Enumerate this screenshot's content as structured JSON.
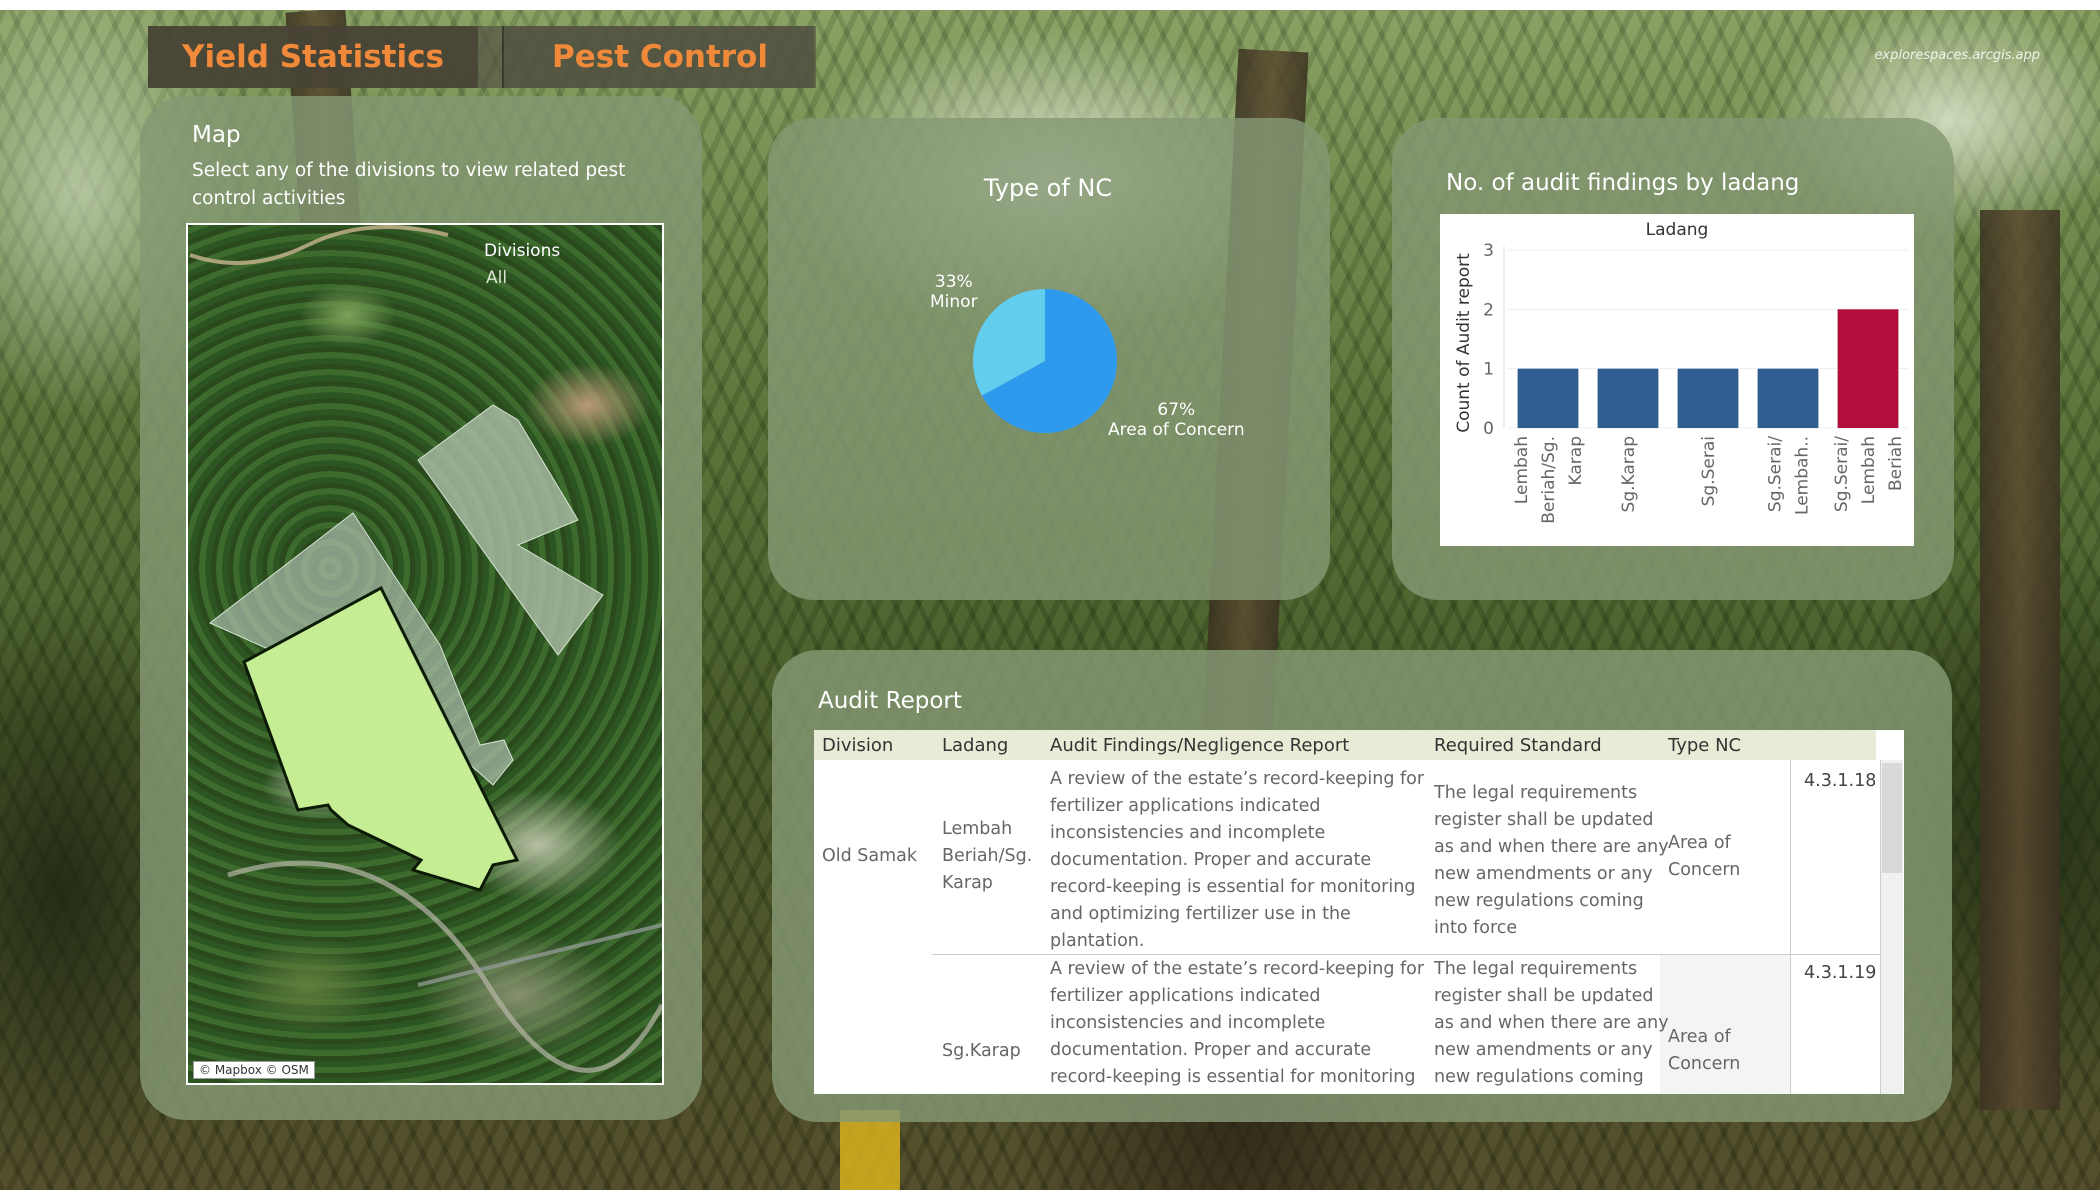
{
  "tabs": [
    {
      "label": "Yield Statistics",
      "active": true
    },
    {
      "label": "Pest Control",
      "active": false
    }
  ],
  "header_url": "explorespaces.arcgis.app",
  "map_panel": {
    "title": "Map",
    "subtitle_line1": "Select any of the divisions to view related pest",
    "subtitle_line2": "control activities",
    "filter_label": "Divisions",
    "filter_value": "All",
    "credit": "© Mapbox © OSM",
    "highlight_color": "#c5ee94"
  },
  "nc_panel": {
    "title": "Type of NC",
    "slices": [
      {
        "name": "Minor",
        "percent": "33%",
        "value": 33,
        "color": "#63cdee"
      },
      {
        "name": "Area of Concern",
        "percent": "67%",
        "value": 67,
        "color": "#2d9aee"
      }
    ]
  },
  "audit_chart": {
    "title": "No. of audit findings by ladang",
    "header": "Ladang",
    "ylabel": "Count of Audit report",
    "colors": {
      "normal": "#2f5d8f",
      "highlight": "#b20e3b"
    },
    "chart_data": {
      "type": "bar",
      "categories": [
        "Lembah Beriah/Sg. Karap",
        "Sg.Karap",
        "Sg.Serai",
        "Sg.Serai/ Lembah..",
        "Sg.Serai/ Lembah Beriah"
      ],
      "tick_lines": [
        [
          "Lembah",
          "Beriah/Sg.",
          "Karap"
        ],
        [
          "Sg.Karap"
        ],
        [
          "Sg.Serai"
        ],
        [
          "Sg.Serai/",
          "Lembah.."
        ],
        [
          "Sg.Serai/",
          "Lembah",
          "Beriah"
        ]
      ],
      "values": [
        1,
        1,
        1,
        1,
        2
      ],
      "yticks": [
        "0",
        "1",
        "2",
        "3"
      ],
      "ylim": [
        0,
        3
      ],
      "ylabel": "Count of Audit report",
      "grid": true
    }
  },
  "audit_report": {
    "title": "Audit Report",
    "columns": [
      "Division",
      "Ladang",
      "Audit Findings/Negligence Report",
      "Required Standard",
      "Type NC"
    ],
    "division": "Old Samak",
    "rows": [
      {
        "ladang": [
          "Lembah",
          "Beriah/Sg.",
          "Karap"
        ],
        "finding": [
          "A review of the estate’s record-keeping for",
          "fertilizer applications indicated",
          "inconsistencies and incomplete",
          "documentation. Proper and accurate",
          "record-keeping is essential for monitoring",
          "and optimizing fertilizer use in the",
          "plantation."
        ],
        "standard": [
          "The legal requirements",
          "register shall be updated",
          "as and when there are any",
          "new amendments or any",
          "new regulations coming",
          "into force"
        ],
        "type_nc": [
          "Area of",
          "Concern"
        ],
        "code": "4.3.1.18"
      },
      {
        "ladang": [
          "Sg.Karap"
        ],
        "finding": [
          "A review of the estate’s record-keeping for",
          "fertilizer applications indicated",
          "inconsistencies and incomplete",
          "documentation. Proper and accurate",
          "record-keeping is essential for monitoring"
        ],
        "standard": [
          "The legal requirements",
          "register shall be updated",
          "as and when there are any",
          "new amendments or any",
          "new regulations coming"
        ],
        "type_nc": [
          "Area of",
          "Concern"
        ],
        "code": "4.3.1.19"
      }
    ]
  }
}
